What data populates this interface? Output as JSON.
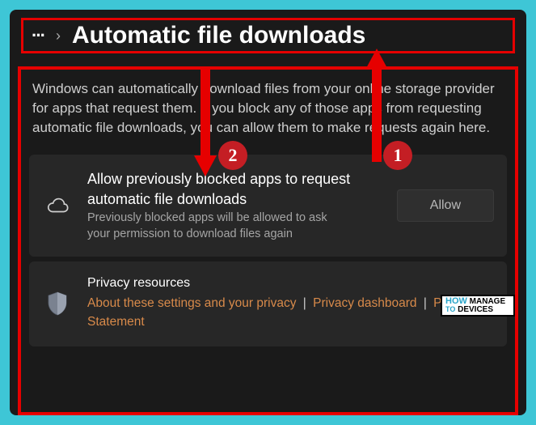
{
  "header": {
    "more_label": "···",
    "chevron": "›",
    "title": "Automatic file downloads"
  },
  "description": "Windows can automatically download files from your online storage provider for apps that request them. If you block any of those apps from requesting automatic file downloads, you can allow them to make requests again here.",
  "card_allow": {
    "title": "Allow previously blocked apps to request automatic file downloads",
    "subtitle": "Previously blocked apps will be allowed to ask your permission to download files again",
    "button": "Allow"
  },
  "card_privacy": {
    "title": "Privacy resources",
    "link1": "About these settings and your privacy",
    "link2": "Privacy dashboard",
    "link3": "Privacy Statement",
    "sep": "|"
  },
  "annotations": {
    "badge1": "1",
    "badge2": "2"
  },
  "watermark": {
    "line1": "HOW",
    "line2": "MANAGE",
    "line3": "TO",
    "line4": "DEVICES"
  }
}
